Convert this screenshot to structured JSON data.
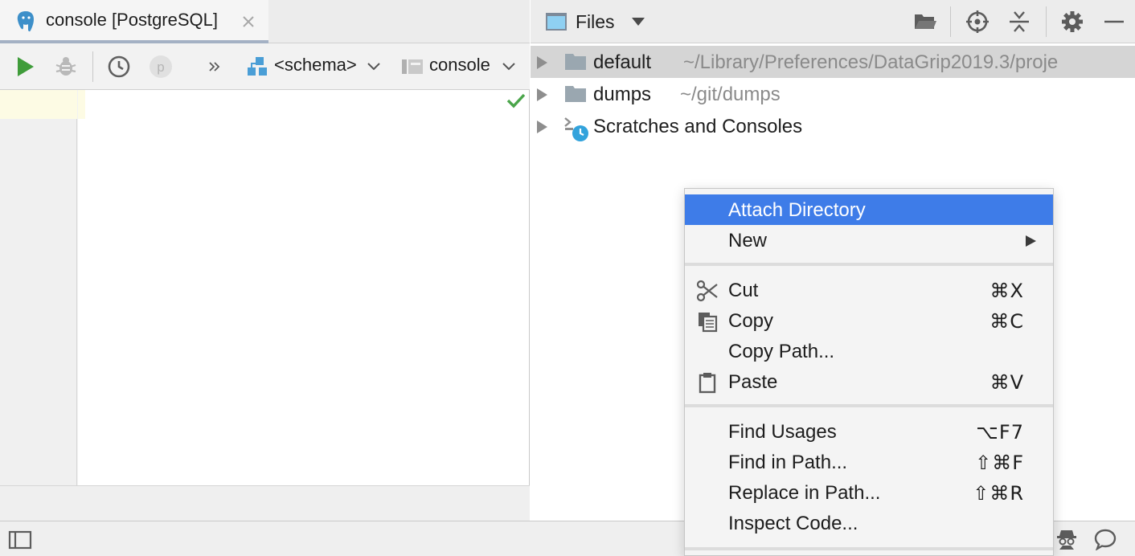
{
  "console_tab": {
    "title": "console [PostgreSQL]",
    "icon": "postgresql-elephant-icon",
    "close_icon": "close-icon"
  },
  "editor_toolbar": {
    "icons": [
      "run-icon",
      "debug-icon",
      "history-icon",
      "p-icon",
      "more-icon"
    ],
    "schema_label": "<schema>",
    "console_label": "console",
    "colors": {
      "run": "#3f9c3a",
      "disabled": "#b9b9b9",
      "schema_icon": "#4a9ed6"
    }
  },
  "editor": {
    "status_icon": "check-icon",
    "status_color": "#4aa54a"
  },
  "files_panel": {
    "title": "Files",
    "icons": [
      "open-folder-icon",
      "locate-icon",
      "collapse-all-icon",
      "gear-icon",
      "minimize-icon"
    ]
  },
  "tree": [
    {
      "name": "default",
      "path": "~/Library/Preferences/DataGrip2019.3/proje",
      "icon": "folder-icon",
      "selected": true
    },
    {
      "name": "dumps",
      "path": "~/git/dumps",
      "icon": "folder-icon",
      "selected": false
    },
    {
      "name": "Scratches and Consoles",
      "path": "",
      "icon": "scratches-icon",
      "selected": false
    }
  ],
  "context_menu": {
    "items": [
      {
        "label": "Attach Directory",
        "shortcut": "",
        "icon": "",
        "highlighted": true
      },
      {
        "label": "New",
        "shortcut": "",
        "icon": "",
        "submenu": true
      },
      {
        "label": "Cut",
        "shortcut": "⌘X",
        "icon": "scissors-icon"
      },
      {
        "label": "Copy",
        "shortcut": "⌘C",
        "icon": "copy-icon"
      },
      {
        "label": "Copy Path...",
        "shortcut": "",
        "icon": ""
      },
      {
        "label": "Paste",
        "shortcut": "⌘V",
        "icon": "clipboard-icon"
      },
      {
        "label": "Find Usages",
        "shortcut": "⌥F7",
        "icon": ""
      },
      {
        "label": "Find in Path...",
        "shortcut": "⇧⌘F",
        "icon": ""
      },
      {
        "label": "Replace in Path...",
        "shortcut": "⇧⌘R",
        "icon": ""
      },
      {
        "label": "Inspect Code...",
        "shortcut": "",
        "icon": ""
      }
    ],
    "highlight_color": "#3e7ce8"
  },
  "status_bar": {
    "icons": [
      "panel-toggle-icon",
      "inspector-icon",
      "chat-bubble-icon"
    ]
  }
}
